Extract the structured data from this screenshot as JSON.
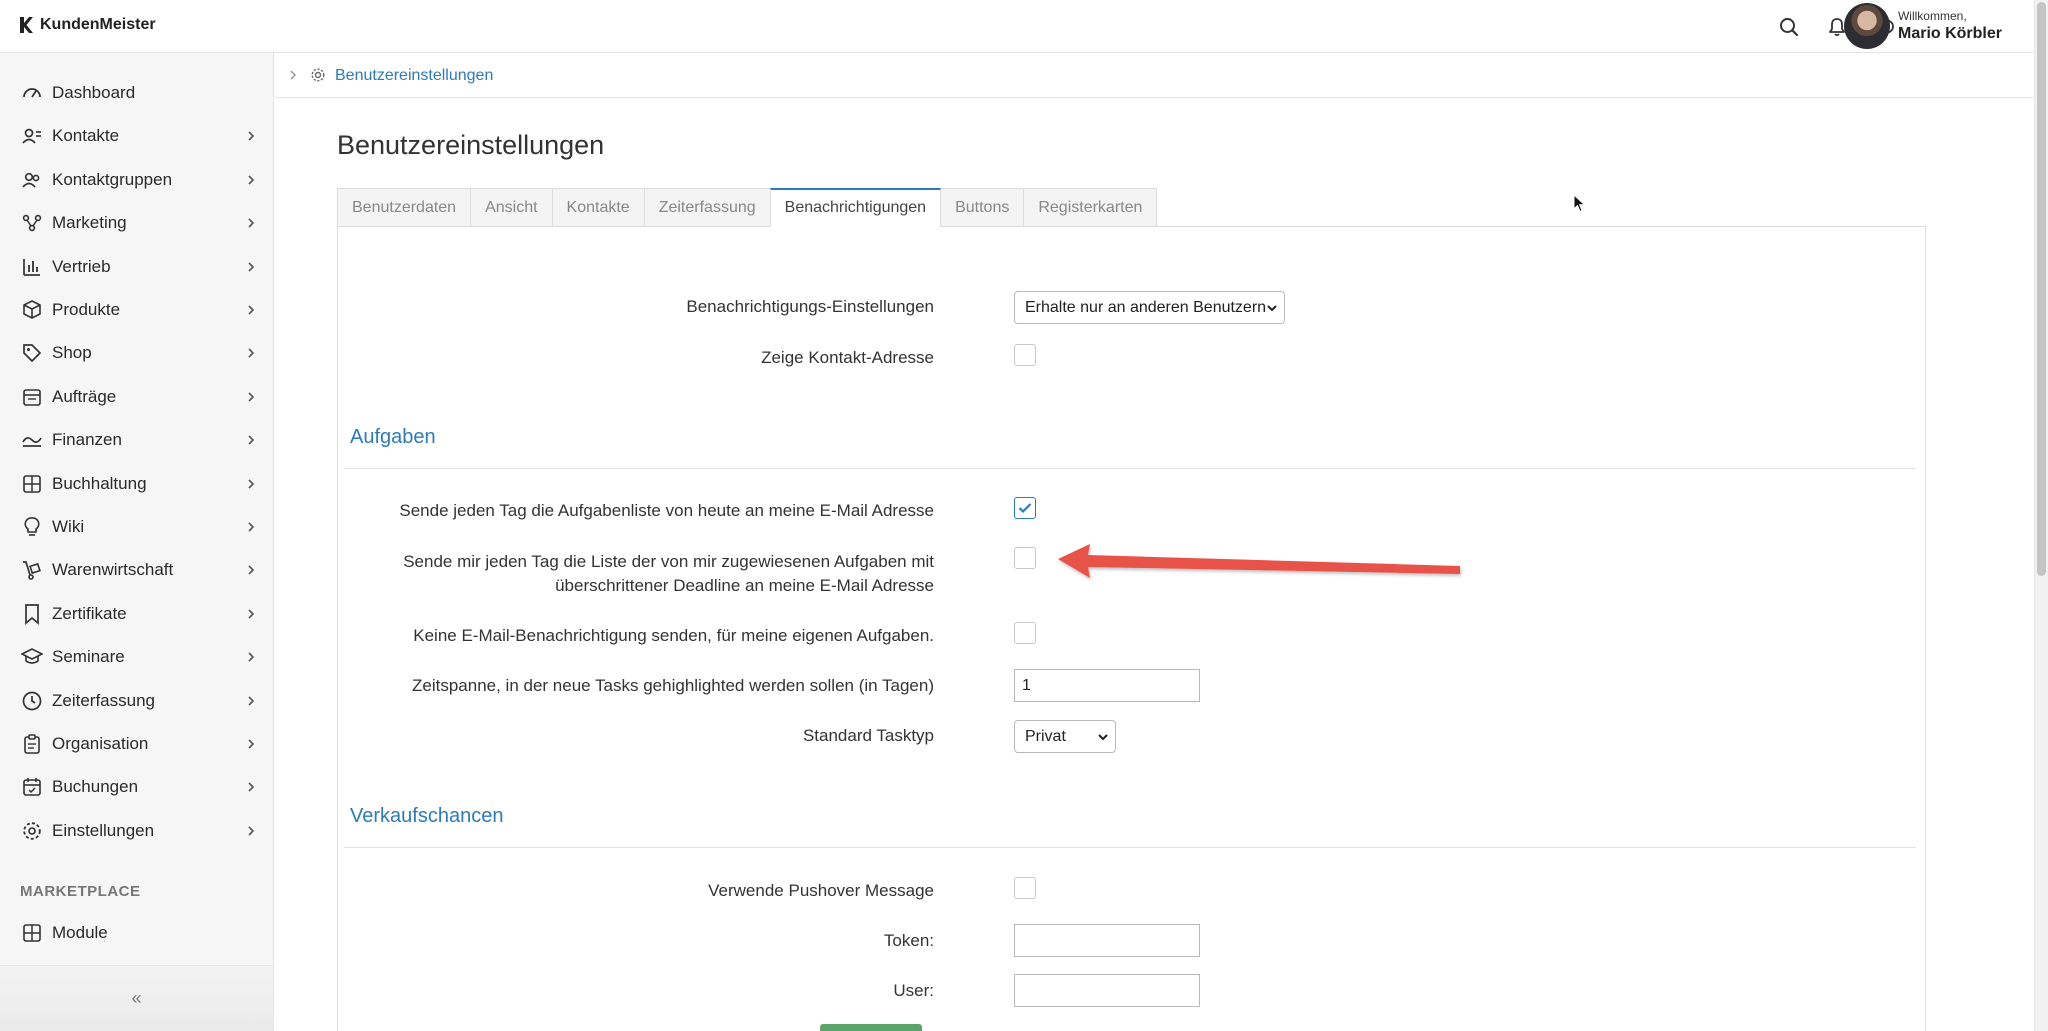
{
  "app": {
    "name": "KundenMeister",
    "greeting": "Willkommen,",
    "user_name": "Mario Körbler"
  },
  "topbar_icons": [
    "search-icon",
    "bell-icon",
    "chat-icon"
  ],
  "sidebar": {
    "items": [
      {
        "label": "Dashboard",
        "icon": "dashboard-icon",
        "has_children": false
      },
      {
        "label": "Kontakte",
        "icon": "contacts-icon",
        "has_children": true
      },
      {
        "label": "Kontaktgruppen",
        "icon": "groups-icon",
        "has_children": true
      },
      {
        "label": "Marketing",
        "icon": "marketing-icon",
        "has_children": true
      },
      {
        "label": "Vertrieb",
        "icon": "chart-icon",
        "has_children": true
      },
      {
        "label": "Produkte",
        "icon": "box-icon",
        "has_children": true
      },
      {
        "label": "Shop",
        "icon": "tag-icon",
        "has_children": true
      },
      {
        "label": "Aufträge",
        "icon": "orders-icon",
        "has_children": true
      },
      {
        "label": "Finanzen",
        "icon": "money-icon",
        "has_children": true
      },
      {
        "label": "Buchhaltung",
        "icon": "ledger-icon",
        "has_children": true
      },
      {
        "label": "Wiki",
        "icon": "lightbulb-icon",
        "has_children": true
      },
      {
        "label": "Warenwirtschaft",
        "icon": "dolly-icon",
        "has_children": true
      },
      {
        "label": "Zertifikate",
        "icon": "bookmark-icon",
        "has_children": true
      },
      {
        "label": "Seminare",
        "icon": "graduation-icon",
        "has_children": true
      },
      {
        "label": "Zeiterfassung",
        "icon": "clock-icon",
        "has_children": true
      },
      {
        "label": "Organisation",
        "icon": "clipboard-icon",
        "has_children": true
      },
      {
        "label": "Buchungen",
        "icon": "calendar-icon",
        "has_children": true
      },
      {
        "label": "Einstellungen",
        "icon": "gear-icon",
        "has_children": true
      }
    ],
    "marketplace_label": "MARKETPLACE",
    "marketplace_items": [
      {
        "label": "Module",
        "icon": "modules-icon"
      }
    ],
    "collapse_label": "«"
  },
  "breadcrumb": {
    "current": "Benutzereinstellungen"
  },
  "page": {
    "title": "Benutzereinstellungen",
    "tabs": [
      {
        "label": "Benutzerdaten",
        "active": false
      },
      {
        "label": "Ansicht",
        "active": false
      },
      {
        "label": "Kontakte",
        "active": false
      },
      {
        "label": "Zeiterfassung",
        "active": false
      },
      {
        "label": "Benachrichtigungen",
        "active": true
      },
      {
        "label": "Buttons",
        "active": false
      },
      {
        "label": "Registerkarten",
        "active": false
      }
    ]
  },
  "general": {
    "notification_settings_label": "Benachrichtigungs-Einstellungen",
    "notification_settings_value": "Erhalte nur an anderen Benutzern",
    "show_contact_address_label": "Zeige Kontakt-Adresse",
    "show_contact_address_checked": false
  },
  "tasks": {
    "heading": "Aufgaben",
    "daily_list_label": "Sende jeden Tag die Aufgabenliste von heute an meine E-Mail Adresse",
    "daily_list_checked": true,
    "overdue_label_line1": "Sende mir jeden Tag die Liste der von mir zugewiesenen Aufgaben mit",
    "overdue_label_line2": "überschrittener Deadline an meine E-Mail Adresse",
    "overdue_checked": false,
    "no_own_email_label": "Keine E-Mail-Benachrichtigung senden, für meine eigenen Aufgaben.",
    "no_own_email_checked": false,
    "highlight_days_label": "Zeitspanne, in der neue Tasks gehighlighted werden sollen (in Tagen)",
    "highlight_days_value": "1",
    "default_type_label": "Standard Tasktyp",
    "default_type_value": "Privat"
  },
  "sales": {
    "heading": "Verkaufschancen",
    "pushover_label": "Verwende Pushover Message",
    "pushover_checked": false,
    "token_label": "Token:",
    "token_value": "",
    "user_label": "User:",
    "user_value": ""
  },
  "colors": {
    "accent": "#2b7bb9",
    "annotation_arrow": "#e8524a",
    "save_button": "#5aa469"
  }
}
